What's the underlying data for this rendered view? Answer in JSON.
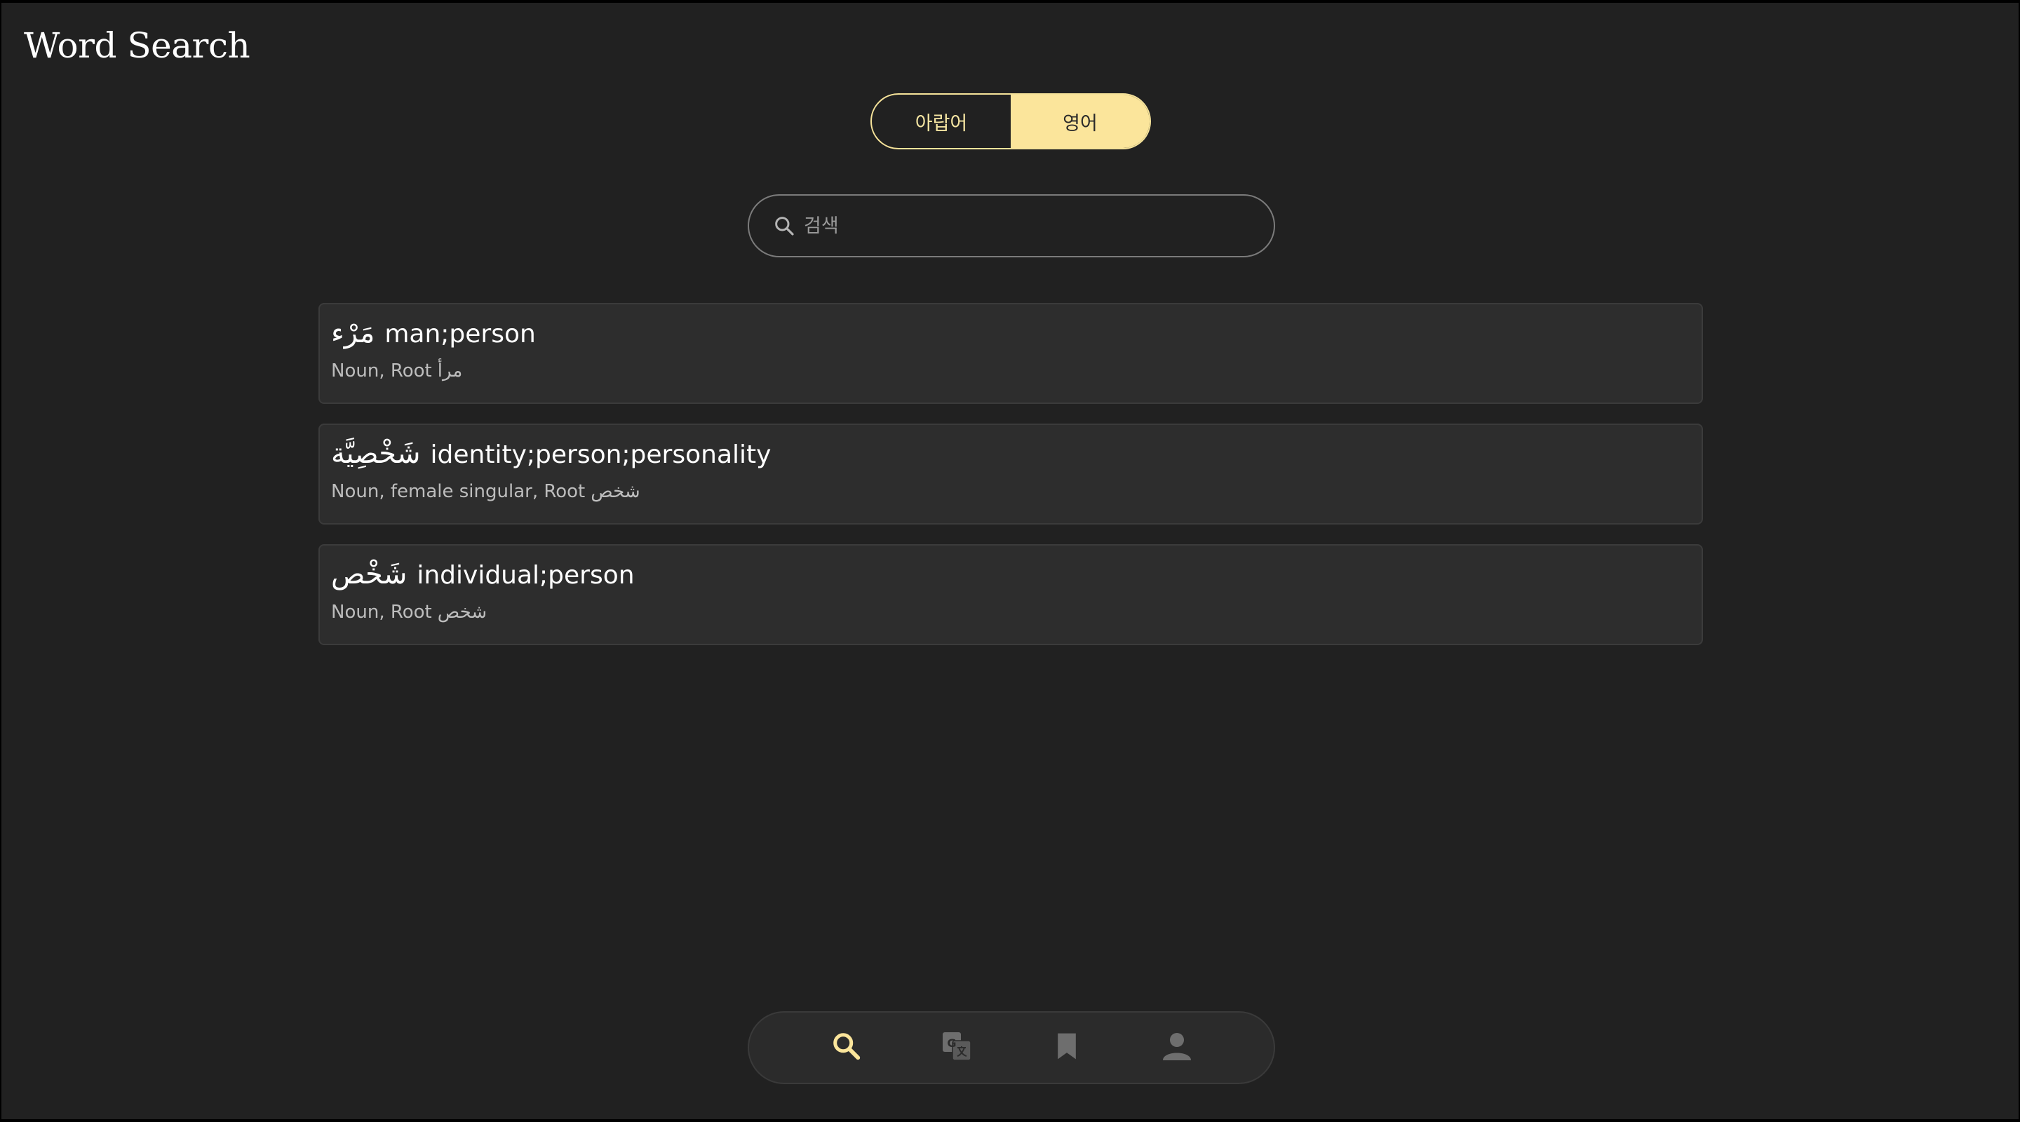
{
  "app": {
    "title": "Word Search"
  },
  "toggle": {
    "options": [
      "아랍어",
      "영어"
    ],
    "selected": "영어"
  },
  "search": {
    "placeholder": "검색",
    "value": ""
  },
  "results": [
    {
      "arabic": "مَرْء",
      "english": "man;person",
      "meta": "Noun, Root",
      "root": "مرأ"
    },
    {
      "arabic": "شَخْصِيَّة",
      "english": "identity;person;personality",
      "meta": "Noun, female singular, Root",
      "root": "شخص"
    },
    {
      "arabic": "شَخْص",
      "english": "individual;person",
      "meta": "Noun, Root",
      "root": "شخص"
    }
  ],
  "nav": {
    "items": [
      {
        "icon": "search-icon",
        "active": true
      },
      {
        "icon": "translate-icon",
        "active": false
      },
      {
        "icon": "bookmark-icon",
        "active": false
      },
      {
        "icon": "person-icon",
        "active": false
      }
    ]
  },
  "colors": {
    "background": "#212121",
    "accent": "#fbe59b",
    "card": "#2d2d2d",
    "inactive_icon": "#6e6e6e"
  }
}
